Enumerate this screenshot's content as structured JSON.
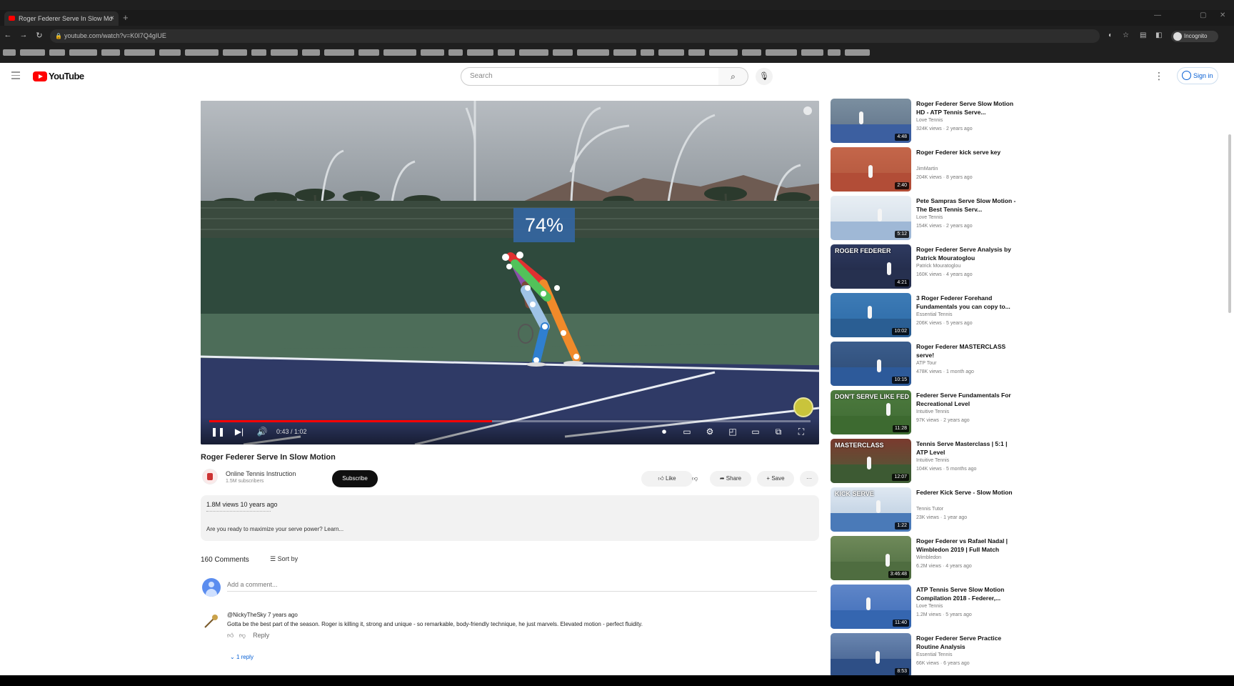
{
  "browser": {
    "tab_title": "Roger Federer Serve In Slow Mo",
    "tab_close": "×",
    "new_tab": "+",
    "url": "youtube.com/watch?v=K0I7Q4gIUE",
    "profile": "Incognito"
  },
  "masthead": {
    "logo": "YouTube",
    "search_placeholder": "Search",
    "signin": "Sign in"
  },
  "player": {
    "overlay_percent": "74%",
    "time": "0:43 / 1:02",
    "progress_fraction": 0.47
  },
  "video": {
    "title": "Roger Federer Serve In Slow Motion",
    "channel": "Online Tennis Instruction",
    "subscribers": "1.5M subscribers",
    "subscribe": "Subscribe",
    "like": "Like",
    "share": "Share",
    "save": "Save",
    "more": "···"
  },
  "description": {
    "meta": "1.8M views  10 years ago",
    "text": "Are you ready to maximize your serve power? Learn..."
  },
  "comments": {
    "count": "160 Comments",
    "sort": "Sort by",
    "add_placeholder": "Add a comment...",
    "first": {
      "author": "@NickyTheSky  7 years ago",
      "text": "Gotta be the best part of the season. Roger is killing it, strong and unique - so remarkable, body-friendly technique, he just marvels. Elevated motion - perfect fluidity.",
      "reply": "Reply",
      "replies": "1 reply"
    }
  },
  "sidebar": {
    "items": [
      {
        "title": "Roger Federer Serve Slow Motion HD - ATP Tennis Serve...",
        "channel": "Love Tennis",
        "meta": "324K views · 2 years ago",
        "duration": "4:48"
      },
      {
        "title": "Roger Federer kick serve key",
        "channel": "JimMartin",
        "meta": "204K views · 8 years ago",
        "duration": "2:40"
      },
      {
        "title": "Pete Sampras Serve Slow Motion - The Best Tennis Serv...",
        "channel": "Love Tennis",
        "meta": "154K views · 2 years ago",
        "duration": "5:12"
      },
      {
        "title": "Roger Federer Serve Analysis by Patrick Mouratoglou",
        "channel": "Patrick Mouratoglou",
        "meta": "160K views · 4 years ago",
        "duration": "4:21"
      },
      {
        "title": "3 Roger Federer Forehand Fundamentals you can copy to...",
        "channel": "Essential Tennis",
        "meta": "206K views · 5 years ago",
        "duration": "10:02"
      },
      {
        "title": "Roger Federer MASTERCLASS serve!",
        "channel": "ATP Tour",
        "meta": "478K views · 1 month ago",
        "duration": "10:15"
      },
      {
        "title": "Federer Serve Fundamentals For Recreational Level",
        "channel": "Intuitive Tennis",
        "meta": "97K views · 2 years ago",
        "duration": "11:28"
      },
      {
        "title": "Tennis Serve Masterclass | 5:1 | ATP Level",
        "channel": "Intuitive Tennis",
        "meta": "104K views · 5 months ago",
        "duration": "12:07"
      },
      {
        "title": "Federer Kick Serve - Slow Motion",
        "channel": "Tennis Tutor",
        "meta": "23K views · 1 year ago",
        "duration": "1:22"
      },
      {
        "title": "Roger Federer vs Rafael Nadal | Wimbledon 2019 | Full Match",
        "channel": "Wimbledon",
        "meta": "6.2M views · 4 years ago",
        "duration": "3:46:48"
      },
      {
        "title": "ATP Tennis Serve Slow Motion Compilation 2018 - Federer,...",
        "channel": "Love Tennis",
        "meta": "1.2M views · 5 years ago",
        "duration": "11:40"
      },
      {
        "title": "Roger Federer Serve Practice Routine Analysis",
        "channel": "Essential Tennis",
        "meta": "66K views · 6 years ago",
        "duration": "8:53"
      }
    ]
  },
  "colors": {
    "brand_red": "#ff0000",
    "link_blue": "#065fd4",
    "court_blue": "#2f3a66",
    "wall_green": "#2f4a3d"
  }
}
